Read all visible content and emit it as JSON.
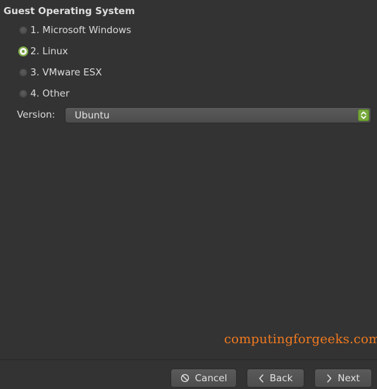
{
  "section": {
    "title": "Guest Operating System"
  },
  "os_options": [
    {
      "label": "1. Microsoft Windows",
      "checked": false
    },
    {
      "label": "2. Linux",
      "checked": true
    },
    {
      "label": "3. VMware ESX",
      "checked": false
    },
    {
      "label": "4. Other",
      "checked": false
    }
  ],
  "version": {
    "label": "Version:",
    "value": "Ubuntu"
  },
  "watermark": "computingforgeeks.com",
  "footer": {
    "cancel": "Cancel",
    "back": "Back",
    "next": "Next"
  },
  "colors": {
    "accent": "#76a83a",
    "watermark": "#f07a20",
    "background": "#333333"
  },
  "icons": [
    "cancel-icon",
    "chevron-left-icon",
    "chevron-right-icon",
    "up-down-arrows-icon"
  ]
}
